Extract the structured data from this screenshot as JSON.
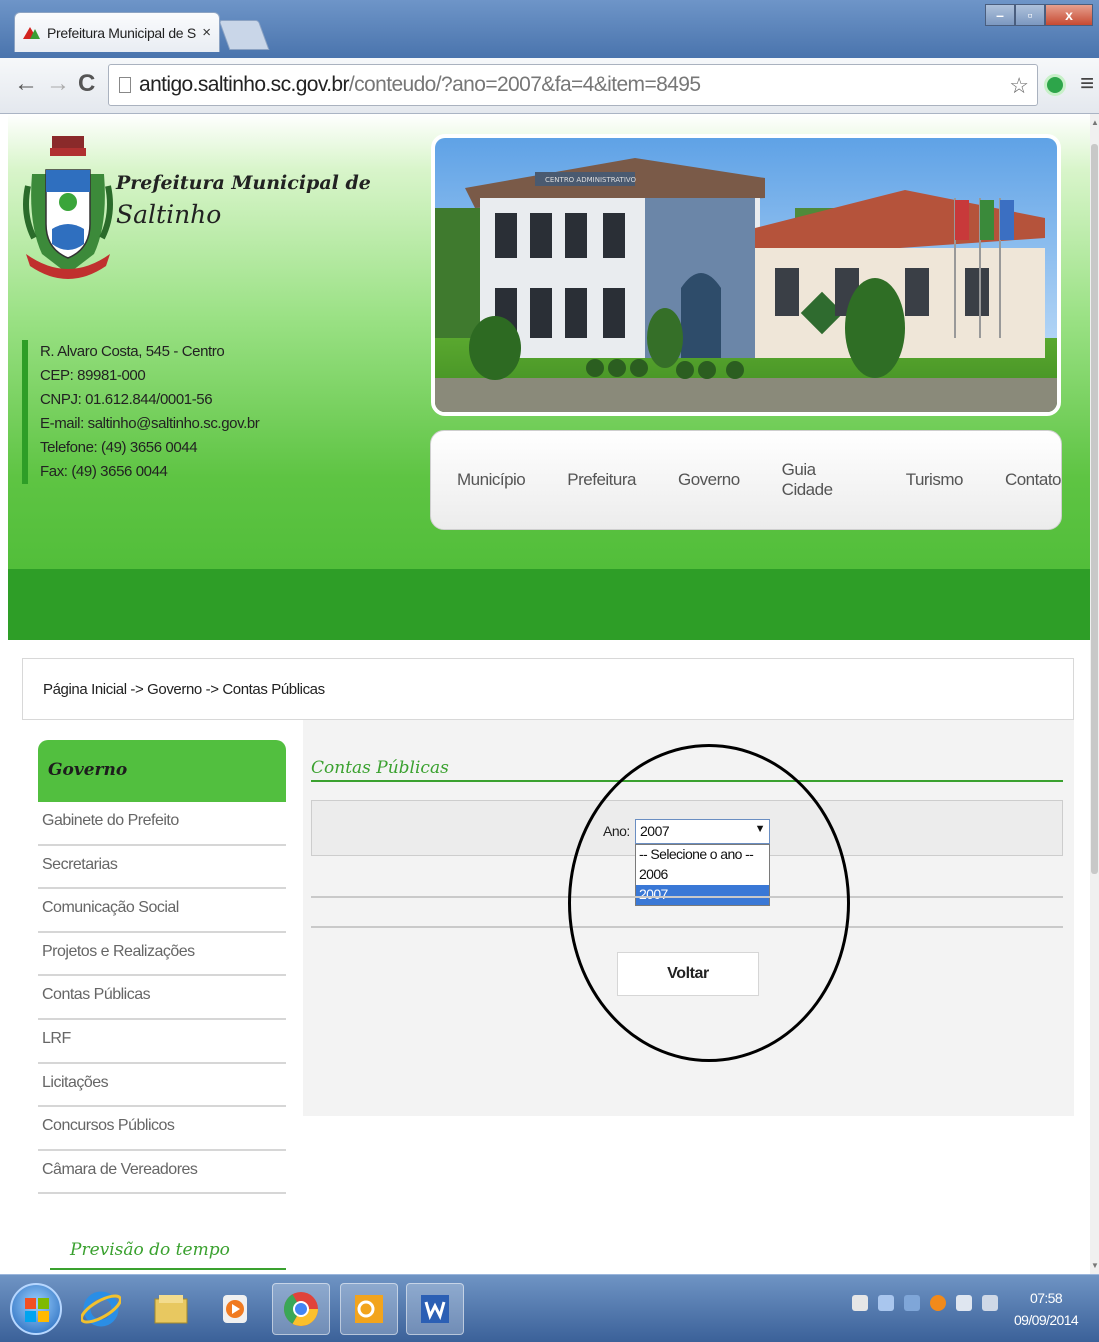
{
  "browser": {
    "tab_title": "Prefeitura Municipal de Sa",
    "tab_close": "×",
    "url_host": "antigo.saltinho.sc.gov.br",
    "url_path": "/conteudo/?ano=2007&fa=4&item=8495",
    "back": "←",
    "forward": "→",
    "reload": "C",
    "bookmark_star": "☆",
    "menu": "≡",
    "window_controls": {
      "minimize": "–",
      "maximize": "▫",
      "close": "x"
    }
  },
  "header": {
    "org_prefix": "Prefeitura Municipal de",
    "org_name": "Saltinho",
    "contact": [
      "R. Alvaro Costa, 545 - Centro",
      "CEP: 89981-000",
      "CNPJ: 01.612.844/0001-56",
      "E-mail: saltinho@saltinho.sc.gov.br",
      "Telefone: (49) 3656 0044",
      "Fax: (49) 3656 0044"
    ],
    "building_sign": "CENTRO ADMINISTRATIVO"
  },
  "menu": [
    "Município",
    "Prefeitura",
    "Governo",
    "Guia Cidade",
    "Turismo",
    "Contato"
  ],
  "breadcrumb": "Página Inicial -> Governo -> Contas Públicas",
  "sidebar": {
    "heading": "Governo",
    "items": [
      "Gabinete do Prefeito",
      "Secretarias",
      "Comunicação Social",
      "Projetos e Realizações",
      "Contas Públicas",
      "LRF",
      "Licitações",
      "Concursos Públicos",
      "Câmara de Vereadores"
    ],
    "weather_title": "Previsão do tempo"
  },
  "content": {
    "title": "Contas Públicas",
    "year_label": "Ano:",
    "year_selected": "2007",
    "year_options": [
      "-- Selecione o ano --",
      "2006",
      "2007"
    ],
    "highlighted_option": "2007",
    "back_button": "Voltar"
  },
  "taskbar": {
    "time": "07:58",
    "date": "09/09/2014"
  },
  "colors": {
    "brand_green": "#2e9e27",
    "sidebar_head_green": "#52bf3f",
    "title_green": "#3aa12f",
    "selection_blue": "#3a78d6"
  }
}
